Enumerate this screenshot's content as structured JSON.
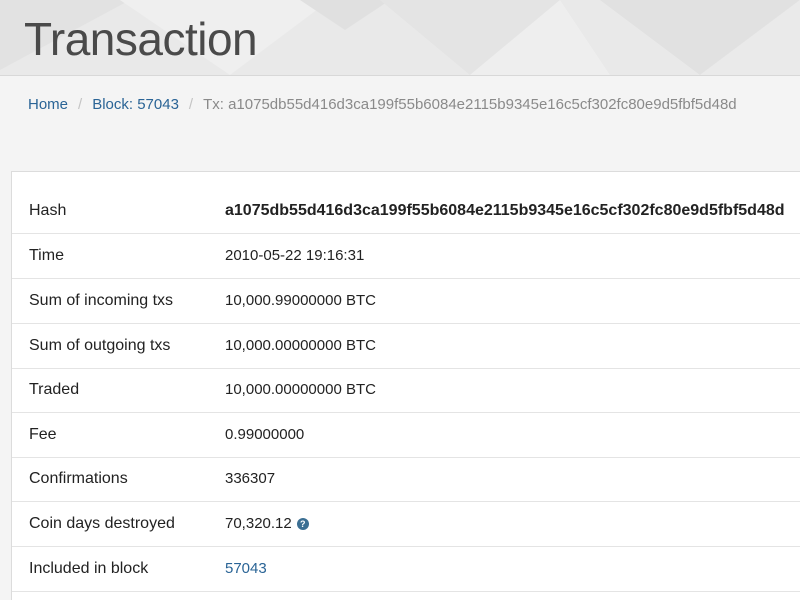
{
  "header": {
    "title": "Transaction"
  },
  "breadcrumb": {
    "home": "Home",
    "block": "Block: 57043",
    "separator": "/",
    "current": "Tx: a1075db55d416d3ca199f55b6084e2115b9345e16c5cf302fc80e9d5fbf5d48d"
  },
  "details": {
    "hash": {
      "label": "Hash",
      "value": "a1075db55d416d3ca199f55b6084e2115b9345e16c5cf302fc80e9d5fbf5d48d"
    },
    "time": {
      "label": "Time",
      "value": "2010-05-22 19:16:31"
    },
    "incoming": {
      "label": "Sum of incoming txs",
      "value": "10,000.99000000 BTC"
    },
    "outgoing": {
      "label": "Sum of outgoing txs",
      "value": "10,000.00000000 BTC"
    },
    "traded": {
      "label": "Traded",
      "value": "10,000.00000000 BTC"
    },
    "fee": {
      "label": "Fee",
      "value": "0.99000000"
    },
    "confirmations": {
      "label": "Confirmations",
      "value": "336307"
    },
    "coin_days": {
      "label": "Coin days destroyed",
      "value": "70,320.12",
      "help_icon": "question-circle-icon",
      "help_glyph": "?"
    },
    "block": {
      "label": "Included in block",
      "value": "57043"
    }
  },
  "colors": {
    "link": "#2a6496",
    "header_bg": "#e9e9e9",
    "help_icon": "#3b6f93"
  }
}
